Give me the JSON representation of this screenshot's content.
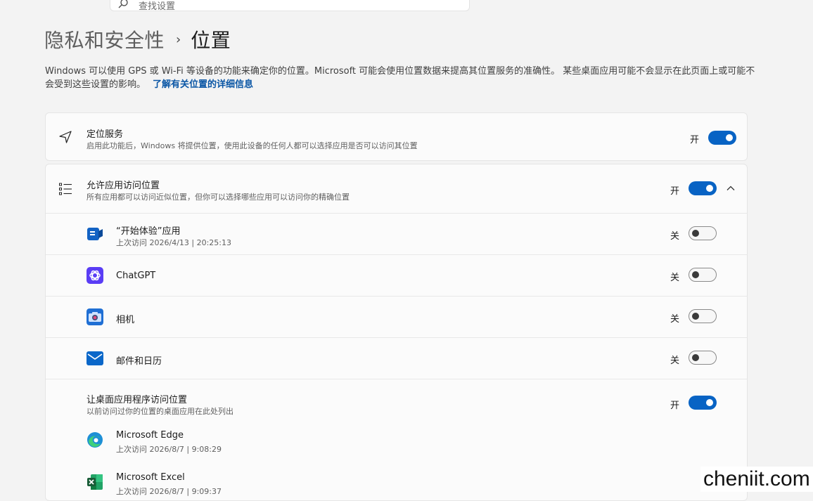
{
  "search": {
    "placeholder": "查找设置"
  },
  "breadcrumb": {
    "parent": "隐私和安全性",
    "separator": "›",
    "current": "位置"
  },
  "description": {
    "text": "Windows 可以使用 GPS 或 Wi-Fi 等设备的功能来确定你的位置。Microsoft 可能会使用位置数据来提高其位置服务的准确性。 某些桌面应用可能不会显示在此页面上或可能不会受到这些设置的影响。",
    "link": "了解有关位置的详细信息"
  },
  "location_service": {
    "title": "定位服务",
    "subtitle": "启用此功能后，Windows 将提供位置，使用此设备的任何人都可以选择应用是否可以访问其位置",
    "state": "开",
    "icon": "navigation-arrow-icon"
  },
  "app_access": {
    "title": "允许应用访问位置",
    "subtitle": "所有应用都可以访问近似位置，但你可以选择哪些应用可以访问你的精确位置",
    "state": "开",
    "icon": "list-icon",
    "expand_icon": "chevron-up-icon",
    "apps": [
      {
        "name": "“开始体验”应用",
        "detail": "上次访问 2026/4/13 | 20:25:13",
        "state": "关",
        "icon": "get-started-icon"
      },
      {
        "name": "ChatGPT",
        "detail": "",
        "state": "关",
        "icon": "chatgpt-icon"
      },
      {
        "name": "相机",
        "detail": "",
        "state": "关",
        "icon": "camera-icon"
      },
      {
        "name": "邮件和日历",
        "detail": "",
        "state": "关",
        "icon": "mail-icon"
      }
    ]
  },
  "desktop_access": {
    "title": "让桌面应用程序访问位置",
    "subtitle": "以前访问过你的位置的桌面应用在此处列出",
    "state": "开",
    "apps": [
      {
        "name": "Microsoft Edge",
        "detail": "上次访问 2026/8/7 | 9:08:29",
        "icon": "edge-icon"
      },
      {
        "name": "Microsoft Excel",
        "detail": "上次访问 2026/8/7 | 9:09:37",
        "icon": "excel-icon"
      }
    ]
  },
  "watermark": "cheniit.com",
  "colors": {
    "accent": "#0863c4",
    "link": "#0a56a5",
    "background": "#f3f3f3"
  }
}
